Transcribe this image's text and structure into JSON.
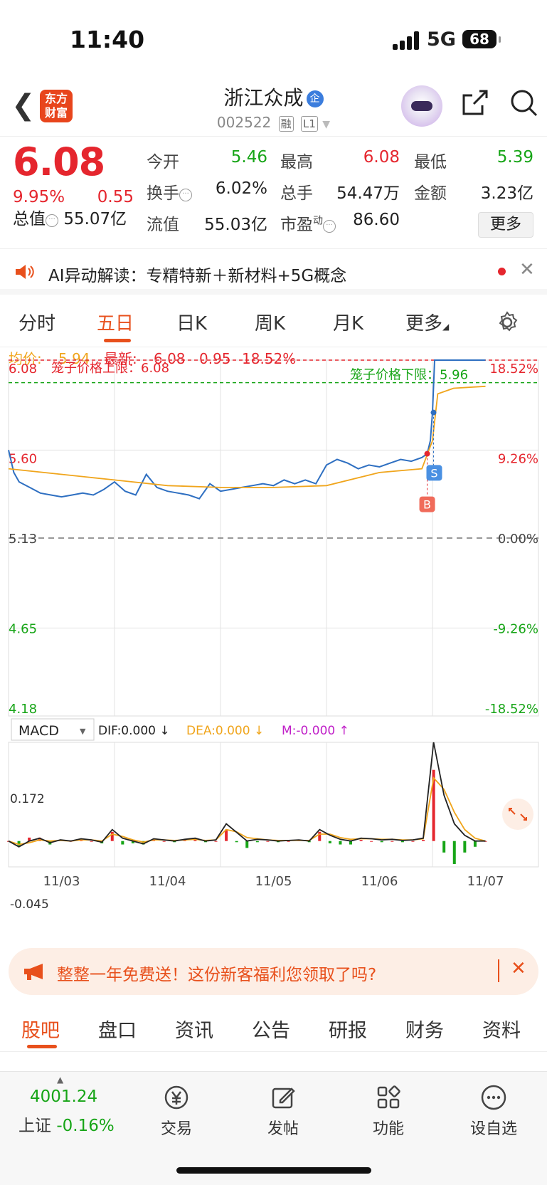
{
  "status": {
    "time": "11:40",
    "network": "5G",
    "battery": "68"
  },
  "header": {
    "logo_line1": "东方",
    "logo_line2": "财富",
    "stock_name": "浙江众成",
    "qi_badge": "企",
    "stock_code": "002522",
    "tag_rong": "融",
    "tag_level": "L1"
  },
  "quote": {
    "price": "6.08",
    "change_pct": "9.95%",
    "change_amt": "0.55",
    "open_label": "今开",
    "open": "5.46",
    "high_label": "最高",
    "high": "6.08",
    "low_label": "最低",
    "low": "5.39",
    "turnover_label": "换手",
    "turnover": "6.02%",
    "volume_label": "总手",
    "volume": "54.47万",
    "amount_label": "金额",
    "amount": "3.23亿",
    "mktcap_label": "总值",
    "mktcap": "55.07亿",
    "float_label": "流值",
    "float": "55.03亿",
    "pe_label": "市盈",
    "pe_sup": "动",
    "pe": "86.60",
    "more_label": "更多"
  },
  "ai_bar": {
    "text": "AI异动解读：专精特新＋新材料+5G概念"
  },
  "chart_tabs": [
    "分时",
    "五日",
    "日K",
    "周K",
    "月K",
    "更多"
  ],
  "chart_data": {
    "type": "line",
    "info": {
      "avg_label": "均价:",
      "avg": "5.94",
      "latest_label": "最新:",
      "latest": "6.08",
      "latest_chg": "0.95",
      "latest_pct": "18.52%"
    },
    "y_left_ticks": [
      "6.08",
      "5.60",
      "5.13",
      "4.65",
      "4.18"
    ],
    "y_right_ticks": [
      "18.52%",
      "9.26%",
      "0.00%",
      "-9.26%",
      "-18.52%"
    ],
    "ylim": [
      4.18,
      6.08
    ],
    "prev_close": 5.13,
    "cage_upper_label": "笼子价格上限：6.08",
    "cage_lower_label": "笼子价格下限：5.96",
    "cage_upper": 6.08,
    "cage_lower": 5.96,
    "x_labels": [
      "11/03",
      "11/04",
      "11/05",
      "11/06",
      "11/07"
    ],
    "buy_marker": "B",
    "sell_marker": "S",
    "series": [
      {
        "name": "price",
        "color": "#2e6fc1",
        "x": [
          0,
          0.05,
          0.1,
          0.2,
          0.3,
          0.4,
          0.5,
          0.6,
          0.7,
          0.8,
          0.9,
          1.0,
          1.1,
          1.2,
          1.3,
          1.4,
          1.5,
          1.6,
          1.7,
          1.8,
          1.9,
          2.0,
          2.1,
          2.2,
          2.3,
          2.4,
          2.5,
          2.6,
          2.7,
          2.8,
          2.9,
          3.0,
          3.1,
          3.2,
          3.3,
          3.4,
          3.5,
          3.6,
          3.7,
          3.8,
          3.9,
          3.95,
          3.98,
          4.0,
          4.02,
          4.5
        ],
        "values": [
          5.6,
          5.48,
          5.43,
          5.4,
          5.37,
          5.36,
          5.35,
          5.36,
          5.37,
          5.36,
          5.39,
          5.43,
          5.38,
          5.36,
          5.47,
          5.4,
          5.38,
          5.37,
          5.36,
          5.34,
          5.42,
          5.38,
          5.39,
          5.4,
          5.41,
          5.42,
          5.41,
          5.44,
          5.42,
          5.44,
          5.42,
          5.52,
          5.55,
          5.53,
          5.5,
          5.52,
          5.51,
          5.53,
          5.55,
          5.54,
          5.56,
          5.58,
          5.65,
          5.8,
          6.08,
          6.08
        ]
      },
      {
        "name": "avg",
        "color": "#f0a51c",
        "x": [
          0,
          0.5,
          1.0,
          1.5,
          2.0,
          2.5,
          3.0,
          3.5,
          3.9,
          4.0,
          4.05,
          4.2,
          4.5
        ],
        "values": [
          5.5,
          5.47,
          5.44,
          5.41,
          5.4,
          5.4,
          5.41,
          5.48,
          5.5,
          5.65,
          5.9,
          5.93,
          5.94
        ]
      }
    ],
    "macd": {
      "selector": "MACD",
      "dif_label": "DIF:0.000 ↓",
      "dea_label": "DEA:0.000 ↓",
      "m_label": "M:-0.000 ↑",
      "y_top": "0.172",
      "y_bottom": "-0.045",
      "ylim": [
        -0.045,
        0.172
      ],
      "dif": [
        0,
        -0.01,
        0.0,
        0.005,
        -0.003,
        0.002,
        0.0,
        0.004,
        0.002,
        -0.002,
        0.02,
        0.005,
        0.0,
        -0.005,
        0.004,
        0.002,
        0.0,
        0.003,
        0.005,
        0.0,
        0.002,
        0.03,
        0.015,
        0.0,
        0.003,
        0.002,
        0.0,
        0.001,
        0.002,
        0.0,
        0.02,
        0.01,
        0.003,
        0.0,
        0.005,
        0.004,
        0.002,
        0.003,
        0.001,
        0.002,
        0.005,
        0.172,
        0.08,
        0.03,
        0.01,
        0.0,
        0.0
      ],
      "dea": [
        0,
        -0.006,
        -0.003,
        0.002,
        0.0,
        0.001,
        0.0,
        0.002,
        0.002,
        0.0,
        0.012,
        0.008,
        0.002,
        -0.002,
        0.002,
        0.002,
        0.001,
        0.002,
        0.003,
        0.001,
        0.002,
        0.02,
        0.016,
        0.006,
        0.004,
        0.002,
        0.001,
        0.001,
        0.001,
        0.001,
        0.012,
        0.012,
        0.006,
        0.003,
        0.004,
        0.004,
        0.003,
        0.003,
        0.002,
        0.002,
        0.004,
        0.11,
        0.09,
        0.05,
        0.02,
        0.005,
        0.0
      ],
      "hist": [
        0,
        -0.008,
        0.006,
        0.006,
        -0.006,
        0.002,
        0.0,
        0.004,
        0.0,
        -0.004,
        0.016,
        -0.006,
        -0.004,
        -0.006,
        0.004,
        0.0,
        -0.002,
        0.002,
        0.004,
        -0.002,
        0.0,
        0.02,
        -0.002,
        -0.012,
        -0.002,
        0.0,
        -0.002,
        0.0,
        0.002,
        -0.002,
        0.016,
        -0.004,
        -0.006,
        -0.006,
        0.002,
        0.0,
        -0.002,
        0.0,
        -0.002,
        0.0,
        0.002,
        0.124,
        -0.02,
        -0.04,
        -0.02,
        -0.01,
        0.0
      ]
    }
  },
  "promo_banner": {
    "text": "整整一年免费送！这份新客福利您领取了吗?"
  },
  "sub_tabs": [
    "股吧",
    "盘口",
    "资讯",
    "公告",
    "研报",
    "财务",
    "资料"
  ],
  "bottom_bar": {
    "index_value": "4001.24",
    "index_name": "上证",
    "index_pct": "-0.16%",
    "items": [
      "交易",
      "发帖",
      "功能",
      "设自选"
    ]
  },
  "colors": {
    "up": "#e5262e",
    "down": "#17a517",
    "accent": "#e8501c",
    "price_line": "#2e6fc1",
    "avg_line": "#f0a51c"
  }
}
